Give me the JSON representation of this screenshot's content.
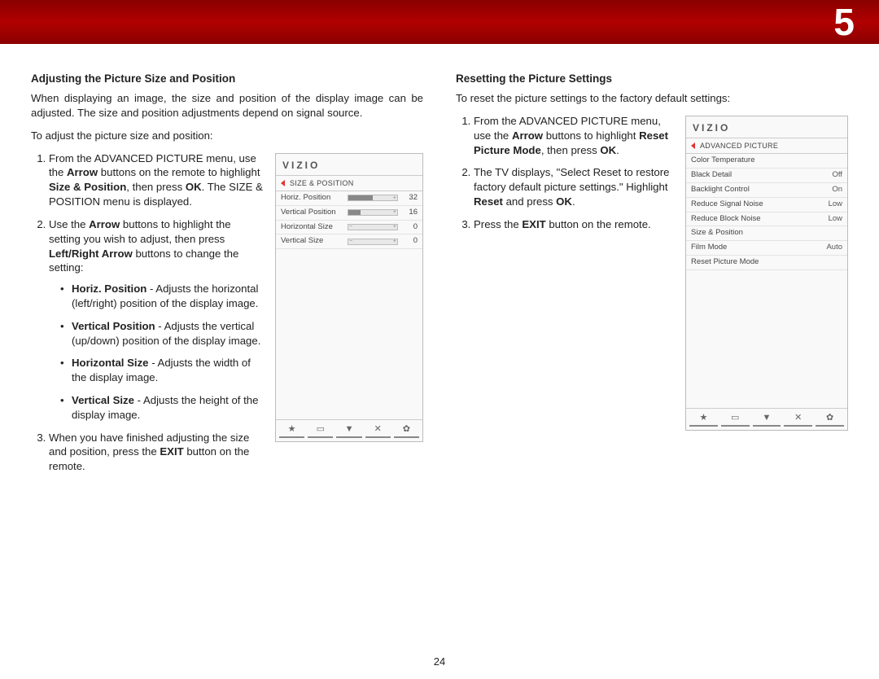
{
  "chapter_number": "5",
  "page_number": "24",
  "left": {
    "heading": "Adjusting the Picture Size and Position",
    "intro": "When displaying an image, the size and position of the display image can be adjusted. The size and position adjustments depend on signal source.",
    "lead": "To adjust the picture size and position:",
    "step1_a": "From the ADVANCED PICTURE menu, use the ",
    "step1_b": "Arrow",
    "step1_c": " buttons on the remote to highlight ",
    "step1_d": "Size & Position",
    "step1_e": ", then press ",
    "step1_f": "OK",
    "step1_g": ". The SIZE & POSITION menu is displayed.",
    "step2_a": "Use the ",
    "step2_b": "Arrow",
    "step2_c": " buttons to highlight the setting you wish to adjust, then press ",
    "step2_d": "Left/Right Arrow",
    "step2_e": " buttons to change the setting:",
    "b1_a": "Horiz. Position",
    "b1_b": " - Adjusts the horizontal (left/right) position of the display image.",
    "b2_a": "Vertical Position",
    "b2_b": " - Adjusts the vertical (up/down) position of the display image.",
    "b3_a": "Horizontal Size",
    "b3_b": " - Adjusts the width of the display image.",
    "b4_a": "Vertical Size",
    "b4_b": " - Adjusts the height of the display image.",
    "step3_a": "When you have finished adjusting the size and position, press the ",
    "step3_b": "EXIT",
    "step3_c": " button on the remote."
  },
  "right": {
    "heading": "Resetting the Picture Settings",
    "intro": "To reset the picture settings to the factory default settings:",
    "step1_a": "From the ADVANCED PICTURE menu, use the ",
    "step1_b": "Arrow",
    "step1_c": " buttons to highlight ",
    "step1_d": "Reset Picture Mode",
    "step1_e": ", then press ",
    "step1_f": "OK",
    "step1_g": ".",
    "step2_a": "The TV displays, \"Select Reset to restore factory default picture settings.\" Highlight ",
    "step2_b": "Reset",
    "step2_c": " and press ",
    "step2_d": "OK",
    "step2_e": ".",
    "step3_a": "Press the ",
    "step3_b": "EXIT",
    "step3_c": " button on the remote."
  },
  "osd1": {
    "brand": "VIZIO",
    "subtitle": "SIZE & POSITION",
    "rows": [
      {
        "label": "Horiz. Position",
        "value": "32",
        "fill": 50
      },
      {
        "label": "Vertical Position",
        "value": "16",
        "fill": 25
      },
      {
        "label": "Horizontal Size",
        "value": "0",
        "fill": 0
      },
      {
        "label": "Vertical Size",
        "value": "0",
        "fill": 0
      }
    ]
  },
  "osd2": {
    "brand": "VIZIO",
    "subtitle": "ADVANCED PICTURE",
    "rows": [
      {
        "label": "Color Temperature",
        "value": ""
      },
      {
        "label": "Black Detail",
        "value": "Off"
      },
      {
        "label": "Backlight Control",
        "value": "On"
      },
      {
        "label": "Reduce Signal Noise",
        "value": "Low"
      },
      {
        "label": "Reduce Block Noise",
        "value": "Low"
      },
      {
        "label": "Size & Position",
        "value": ""
      },
      {
        "label": "Film Mode",
        "value": "Auto"
      },
      {
        "label": "Reset Picture Mode",
        "value": ""
      }
    ]
  },
  "footer_icons": [
    "★",
    "▭",
    "▼",
    "✕",
    "✿"
  ]
}
